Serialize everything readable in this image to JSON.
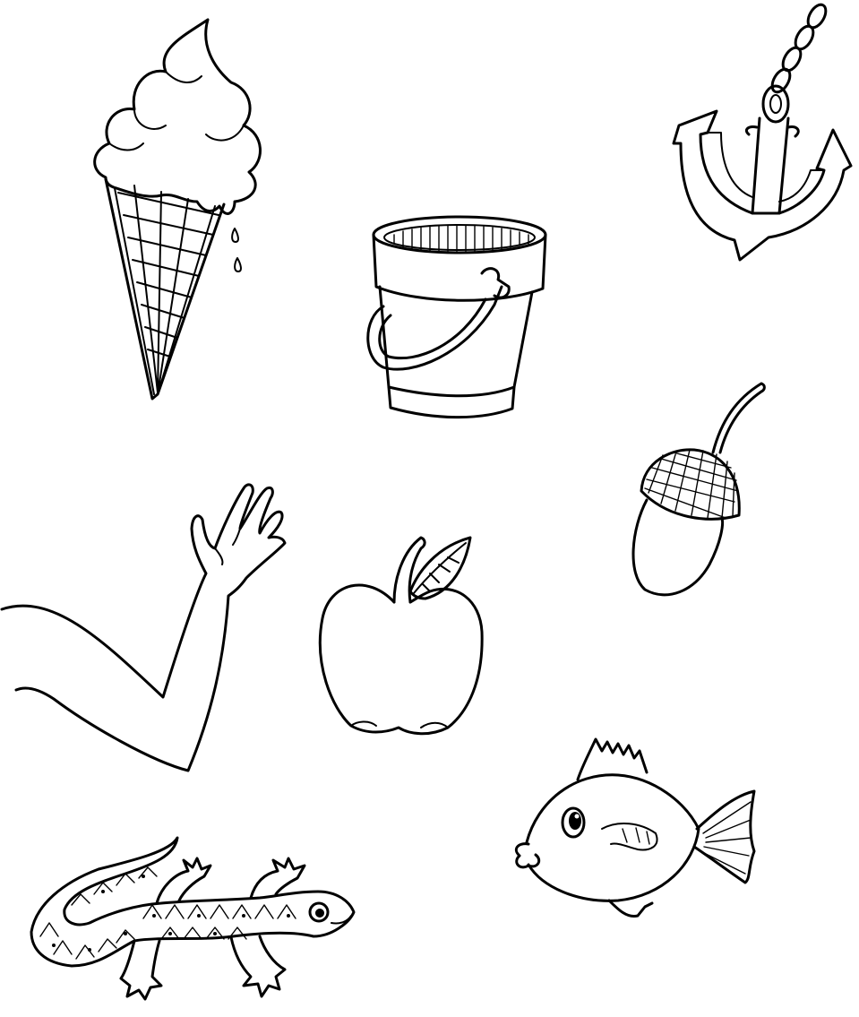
{
  "background_color": "#ffffff",
  "line_color": "#000000",
  "drawings": [
    {
      "icon": "ice-cream-cone-icon"
    },
    {
      "icon": "bucket-icon"
    },
    {
      "icon": "anchor-icon"
    },
    {
      "icon": "acorn-icon"
    },
    {
      "icon": "arm-hand-icon"
    },
    {
      "icon": "apple-icon"
    },
    {
      "icon": "fish-icon"
    },
    {
      "icon": "lizard-icon"
    }
  ]
}
